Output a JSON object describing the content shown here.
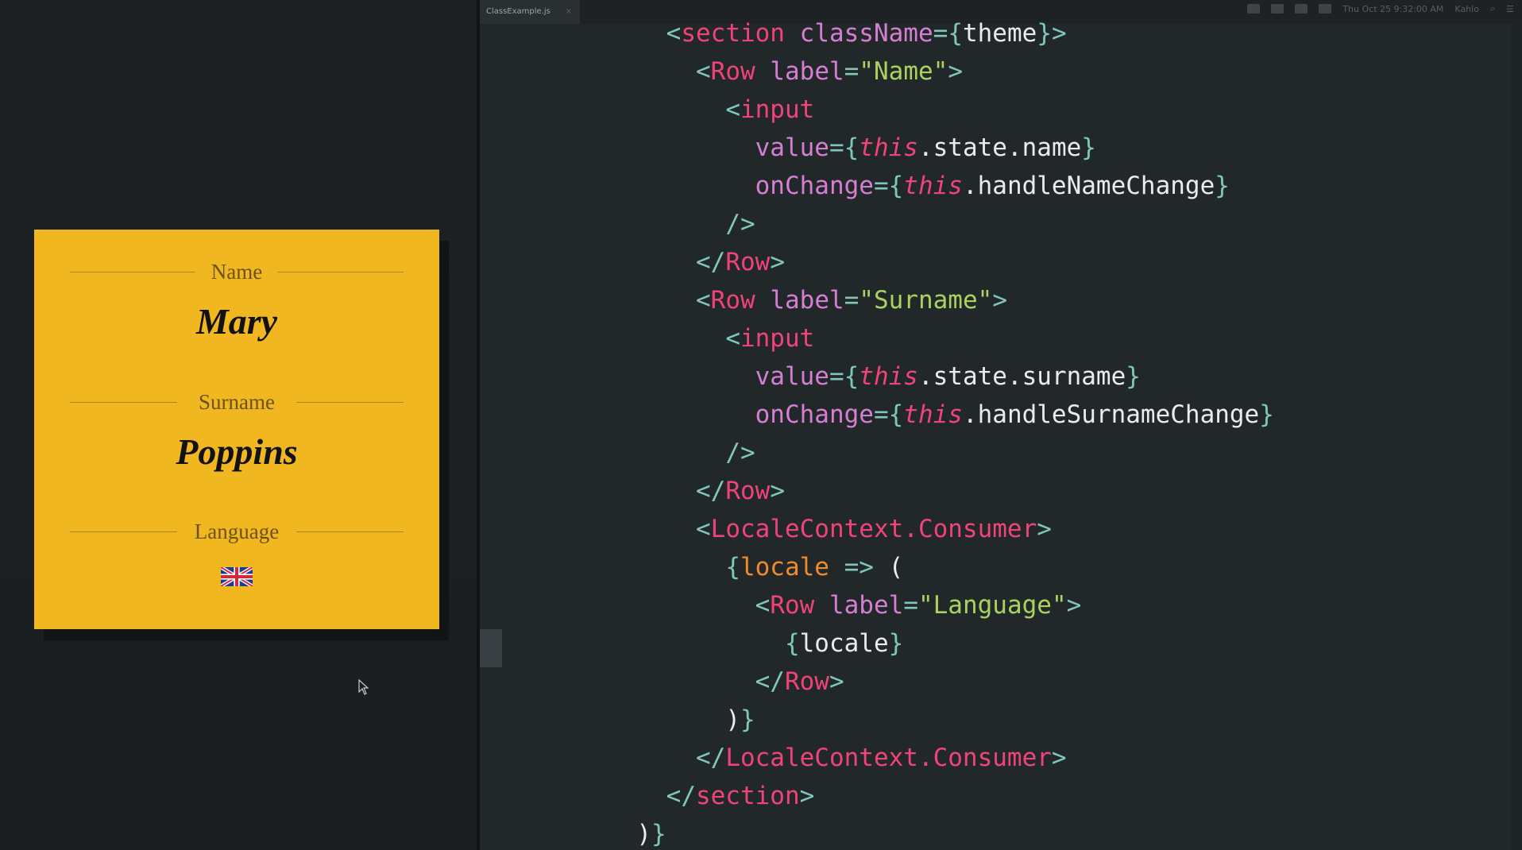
{
  "editor": {
    "tab_label": "ClassExample.js",
    "tab_close": "×",
    "menubar_date": "Thu Oct 25 9:32:00 AM",
    "menubar_user": "Kahlo",
    "code_lines": [
      [
        [
          "    ",
          "t-plain"
        ],
        [
          "<",
          "t-punct"
        ],
        [
          "section",
          "t-tag"
        ],
        [
          " ",
          "t-plain"
        ],
        [
          "className",
          "t-attr"
        ],
        [
          "=",
          "t-punct"
        ],
        [
          "{",
          "t-punct"
        ],
        [
          "theme",
          "t-plain"
        ],
        [
          "}",
          "t-punct"
        ],
        [
          ">",
          "t-punct"
        ]
      ],
      [
        [
          "      ",
          "t-plain"
        ],
        [
          "<",
          "t-punct"
        ],
        [
          "Row",
          "t-tag"
        ],
        [
          " ",
          "t-plain"
        ],
        [
          "label",
          "t-attr"
        ],
        [
          "=",
          "t-punct"
        ],
        [
          "\"Name\"",
          "t-str"
        ],
        [
          ">",
          "t-punct"
        ]
      ],
      [
        [
          "        ",
          "t-plain"
        ],
        [
          "<",
          "t-punct"
        ],
        [
          "input",
          "t-tag"
        ]
      ],
      [
        [
          "          ",
          "t-plain"
        ],
        [
          "value",
          "t-attr"
        ],
        [
          "=",
          "t-punct"
        ],
        [
          "{",
          "t-punct"
        ],
        [
          "this",
          "t-kw"
        ],
        [
          ".state.name",
          "t-plain"
        ],
        [
          "}",
          "t-punct"
        ]
      ],
      [
        [
          "          ",
          "t-plain"
        ],
        [
          "onChange",
          "t-attr"
        ],
        [
          "=",
          "t-punct"
        ],
        [
          "{",
          "t-punct"
        ],
        [
          "this",
          "t-kw"
        ],
        [
          ".handleNameChange",
          "t-plain"
        ],
        [
          "}",
          "t-punct"
        ]
      ],
      [
        [
          "        ",
          "t-plain"
        ],
        [
          "/>",
          "t-punct"
        ]
      ],
      [
        [
          "      ",
          "t-plain"
        ],
        [
          "</",
          "t-punct"
        ],
        [
          "Row",
          "t-tag"
        ],
        [
          ">",
          "t-punct"
        ]
      ],
      [
        [
          "      ",
          "t-plain"
        ],
        [
          "<",
          "t-punct"
        ],
        [
          "Row",
          "t-tag"
        ],
        [
          " ",
          "t-plain"
        ],
        [
          "label",
          "t-attr"
        ],
        [
          "=",
          "t-punct"
        ],
        [
          "\"Surname\"",
          "t-str"
        ],
        [
          ">",
          "t-punct"
        ]
      ],
      [
        [
          "        ",
          "t-plain"
        ],
        [
          "<",
          "t-punct"
        ],
        [
          "input",
          "t-tag"
        ]
      ],
      [
        [
          "          ",
          "t-plain"
        ],
        [
          "value",
          "t-attr"
        ],
        [
          "=",
          "t-punct"
        ],
        [
          "{",
          "t-punct"
        ],
        [
          "this",
          "t-kw"
        ],
        [
          ".state.surname",
          "t-plain"
        ],
        [
          "}",
          "t-punct"
        ]
      ],
      [
        [
          "          ",
          "t-plain"
        ],
        [
          "onChange",
          "t-attr"
        ],
        [
          "=",
          "t-punct"
        ],
        [
          "{",
          "t-punct"
        ],
        [
          "this",
          "t-kw"
        ],
        [
          ".handleSurnameChange",
          "t-plain"
        ],
        [
          "}",
          "t-punct"
        ]
      ],
      [
        [
          "        ",
          "t-plain"
        ],
        [
          "/>",
          "t-punct"
        ]
      ],
      [
        [
          "      ",
          "t-plain"
        ],
        [
          "</",
          "t-punct"
        ],
        [
          "Row",
          "t-tag"
        ],
        [
          ">",
          "t-punct"
        ]
      ],
      [
        [
          "      ",
          "t-plain"
        ],
        [
          "<",
          "t-punct"
        ],
        [
          "LocaleContext.Consumer",
          "t-tag"
        ],
        [
          ">",
          "t-punct"
        ]
      ],
      [
        [
          "        ",
          "t-plain"
        ],
        [
          "{",
          "t-punct"
        ],
        [
          "locale",
          "t-var"
        ],
        [
          " ",
          "t-plain"
        ],
        [
          "=>",
          "t-punct"
        ],
        [
          " (",
          "t-plain"
        ]
      ],
      [
        [
          "          ",
          "t-plain"
        ],
        [
          "<",
          "t-punct"
        ],
        [
          "Row",
          "t-tag"
        ],
        [
          " ",
          "t-plain"
        ],
        [
          "label",
          "t-attr"
        ],
        [
          "=",
          "t-punct"
        ],
        [
          "\"Language\"",
          "t-str"
        ],
        [
          ">",
          "t-punct"
        ]
      ],
      [
        [
          "            ",
          "t-plain"
        ],
        [
          "{",
          "t-punct"
        ],
        [
          "locale",
          "t-plain"
        ],
        [
          "}",
          "t-punct"
        ]
      ],
      [
        [
          "          ",
          "t-plain"
        ],
        [
          "</",
          "t-punct"
        ],
        [
          "Row",
          "t-tag"
        ],
        [
          ">",
          "t-punct"
        ]
      ],
      [
        [
          "        ",
          "t-plain"
        ],
        [
          ")",
          "t-plain"
        ],
        [
          "}",
          "t-punct"
        ]
      ],
      [
        [
          "      ",
          "t-plain"
        ],
        [
          "</",
          "t-punct"
        ],
        [
          "LocaleContext.Consumer",
          "t-tag"
        ],
        [
          ">",
          "t-punct"
        ]
      ],
      [
        [
          "    ",
          "t-plain"
        ],
        [
          "</",
          "t-punct"
        ],
        [
          "section",
          "t-tag"
        ],
        [
          ">",
          "t-punct"
        ]
      ],
      [
        [
          "  ",
          "t-plain"
        ],
        [
          ")",
          "t-plain"
        ],
        [
          "}",
          "t-punct"
        ]
      ]
    ]
  },
  "preview": {
    "rows": [
      {
        "label": "Name",
        "value": "Mary"
      },
      {
        "label": "Surname",
        "value": "Poppins"
      },
      {
        "label": "Language",
        "value_icon": "uk-flag-icon"
      }
    ]
  },
  "colors": {
    "card_background": "#f0b720",
    "editor_background": "#22282a",
    "tag": "#f0437a",
    "attribute": "#d57fd2",
    "string": "#a9d25e",
    "punctuation": "#7fc7bb"
  }
}
